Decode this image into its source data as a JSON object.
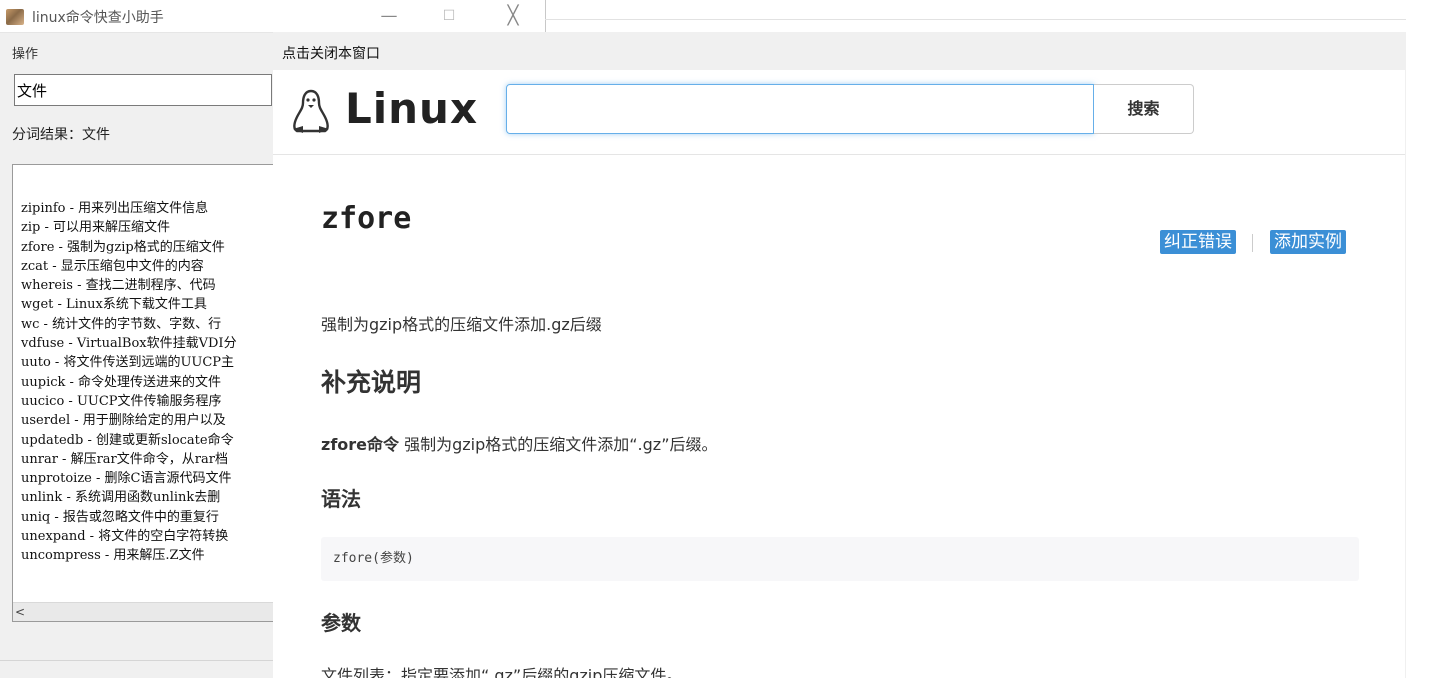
{
  "bg_window": {
    "title": "linux命令快查小助手",
    "controls": {
      "minimize": "—",
      "maximize": "☐",
      "close": "╳"
    },
    "menu": "操作",
    "search_value": "文件",
    "segment_result": "分词结果：文件",
    "command_list": [
      "zipinfo - 用来列出压缩文件信息",
      "zip - 可以用来解压缩文件",
      "zfore - 强制为gzip格式的压缩文件",
      "zcat - 显示压缩包中文件的内容",
      "whereis - 查找二进制程序、代码",
      "wget - Linux系统下载文件工具",
      "wc - 统计文件的字节数、字数、行",
      "vdfuse - VirtualBox软件挂载VDI分",
      "uuto - 将文件传送到远端的UUCP主",
      "uupick - 命令处理传送进来的文件",
      "uucico - UUCP文件传输服务程序",
      "userdel - 用于删除给定的用户以及",
      "updatedb - 创建或更新slocate命令",
      "unrar - 解压rar文件命令，从rar档",
      "unprotoize - 删除C语言源代码文件",
      "unlink - 系统调用函数unlink去删",
      "uniq - 报告或忽略文件中的重复行",
      "unexpand - 将文件的空白字符转换",
      "uncompress - 用来解压.Z文件"
    ],
    "hscroll_left": "<"
  },
  "popup": {
    "close_link": "点击关闭本窗口",
    "logo_text": "Linux",
    "search_placeholder": "",
    "search_button": "搜索",
    "command_name": "zfore",
    "tag_correct": "纠正错误",
    "tag_add_example": "添加实例",
    "description": "强制为gzip格式的压缩文件添加.gz后缀",
    "section_supplement": "补充说明",
    "supplement_cmd": "zfore命令",
    "supplement_rest": " 强制为gzip格式的压缩文件添加“.gz”后缀。",
    "section_syntax": "语法",
    "syntax_code": "zfore(参数)",
    "section_params": "参数",
    "params_text": "文件列表：指定要添加“.gz”后缀的gzip压缩文件。",
    "scroll_up": "^"
  }
}
